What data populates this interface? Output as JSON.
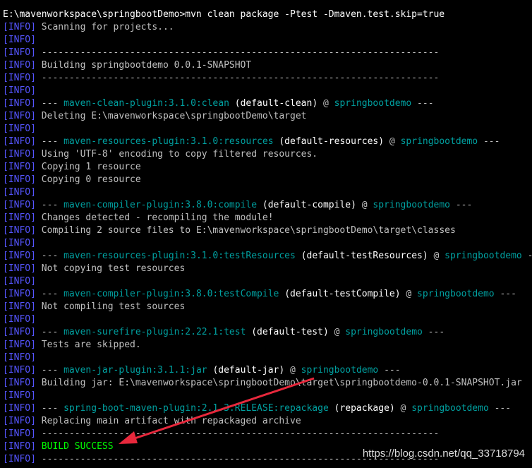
{
  "prompt": {
    "path": "E:\\mavenworkspace\\springbootDemo>",
    "command": "mvn clean package -Ptest -Dmaven.test.skip=true"
  },
  "tag": "[INFO]",
  "dash": "---",
  "at": "@",
  "project": "springbootdemo",
  "separator_line": "------------------------------------------------------------------------",
  "lines": [
    {
      "kind": "text",
      "text": "Scanning for projects..."
    },
    {
      "kind": "blank"
    },
    {
      "kind": "separator"
    },
    {
      "kind": "text",
      "text": "Building springbootdemo 0.0.1-SNAPSHOT"
    },
    {
      "kind": "separator"
    },
    {
      "kind": "blank"
    },
    {
      "kind": "plugin",
      "plugin": "maven-clean-plugin:3.1.0:clean",
      "execution": "(default-clean)"
    },
    {
      "kind": "text",
      "text": "Deleting E:\\mavenworkspace\\springbootDemo\\target"
    },
    {
      "kind": "blank"
    },
    {
      "kind": "plugin",
      "plugin": "maven-resources-plugin:3.1.0:resources",
      "execution": "(default-resources)"
    },
    {
      "kind": "text",
      "text": "Using 'UTF-8' encoding to copy filtered resources."
    },
    {
      "kind": "text",
      "text": "Copying 1 resource"
    },
    {
      "kind": "text",
      "text": "Copying 0 resource"
    },
    {
      "kind": "blank"
    },
    {
      "kind": "plugin",
      "plugin": "maven-compiler-plugin:3.8.0:compile",
      "execution": "(default-compile)"
    },
    {
      "kind": "text",
      "text": "Changes detected - recompiling the module!"
    },
    {
      "kind": "text",
      "text": "Compiling 2 source files to E:\\mavenworkspace\\springbootDemo\\target\\classes"
    },
    {
      "kind": "blank"
    },
    {
      "kind": "plugin",
      "plugin": "maven-resources-plugin:3.1.0:testResources",
      "execution": "(default-testResources)"
    },
    {
      "kind": "text",
      "text": "Not copying test resources"
    },
    {
      "kind": "blank"
    },
    {
      "kind": "plugin",
      "plugin": "maven-compiler-plugin:3.8.0:testCompile",
      "execution": "(default-testCompile)"
    },
    {
      "kind": "text",
      "text": "Not compiling test sources"
    },
    {
      "kind": "blank"
    },
    {
      "kind": "plugin",
      "plugin": "maven-surefire-plugin:2.22.1:test",
      "execution": "(default-test)"
    },
    {
      "kind": "text",
      "text": "Tests are skipped."
    },
    {
      "kind": "blank"
    },
    {
      "kind": "plugin",
      "plugin": "maven-jar-plugin:3.1.1:jar",
      "execution": "(default-jar)"
    },
    {
      "kind": "text",
      "text": "Building jar: E:\\mavenworkspace\\springbootDemo\\target\\springbootdemo-0.0.1-SNAPSHOT.jar"
    },
    {
      "kind": "blank"
    },
    {
      "kind": "plugin",
      "plugin": "spring-boot-maven-plugin:2.1.3.RELEASE:repackage",
      "execution": "(repackage)"
    },
    {
      "kind": "text",
      "text": "Replacing main artifact with repackaged archive"
    },
    {
      "kind": "separator"
    },
    {
      "kind": "success",
      "text": "BUILD SUCCESS"
    },
    {
      "kind": "separator"
    }
  ],
  "watermark": "https://blog.csdn.net/qq_33718794",
  "colors": {
    "background": "#000000",
    "info_tag": "#5555ff",
    "plugin": "#00a0a0",
    "success": "#00ff00",
    "text": "#c0c0c0",
    "annotation_arrow": "#e8283c"
  }
}
